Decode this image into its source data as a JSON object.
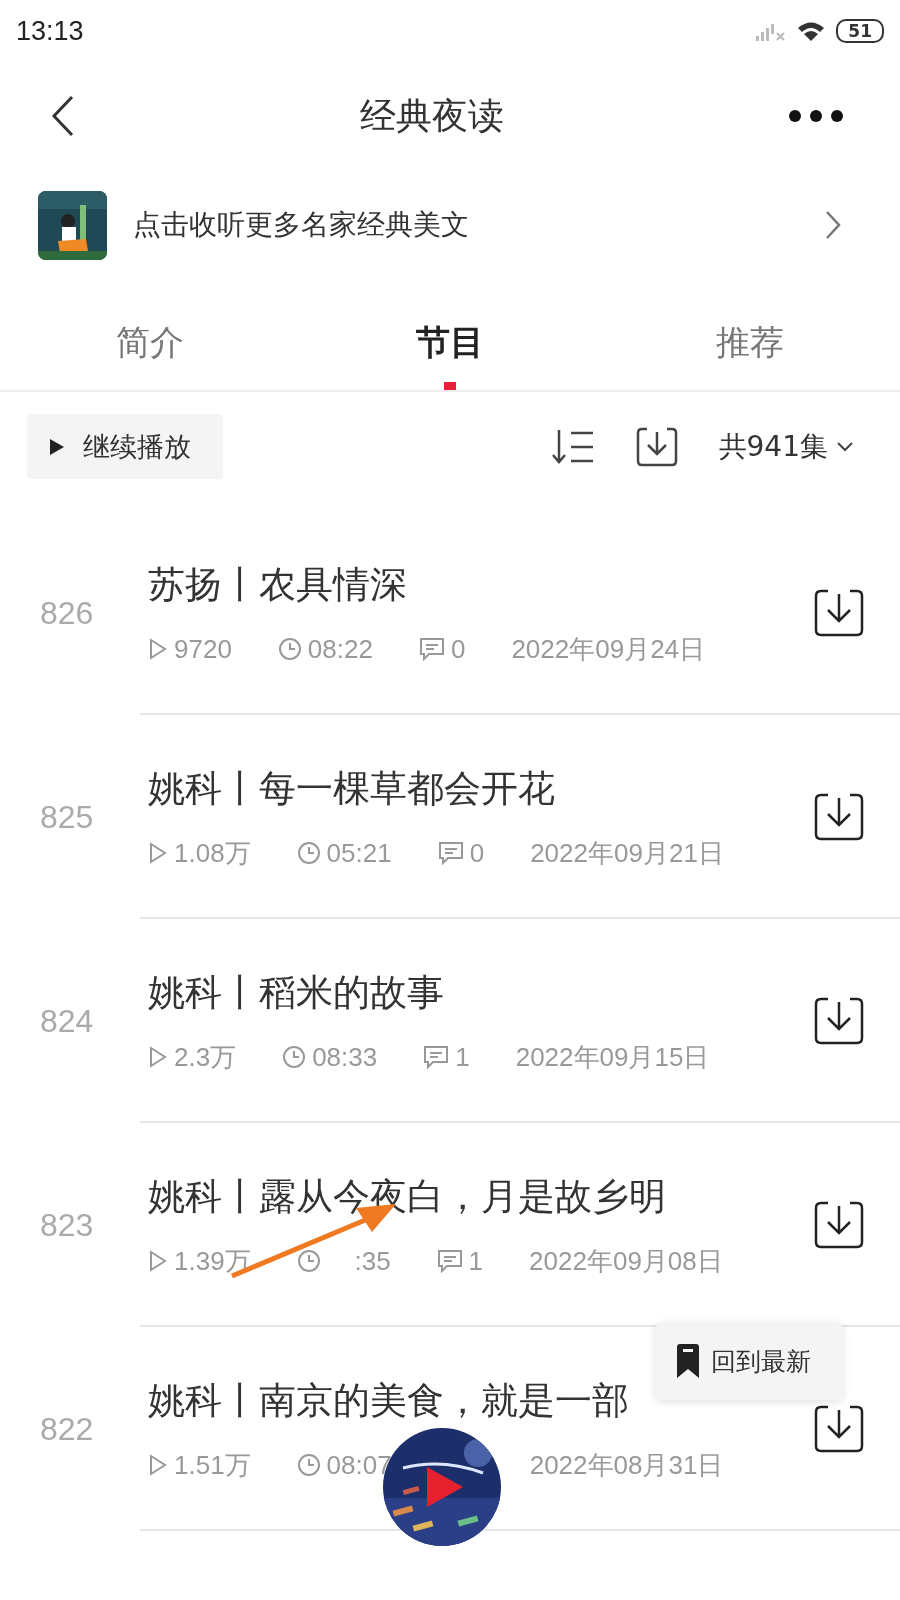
{
  "status_bar": {
    "time": "13:13",
    "battery": "51"
  },
  "header": {
    "title": "经典夜读"
  },
  "banner": {
    "text": "点击收听更多名家经典美文"
  },
  "tabs": [
    {
      "label": "简介",
      "selected": false
    },
    {
      "label": "节目",
      "selected": true
    },
    {
      "label": "推荐",
      "selected": false
    }
  ],
  "toolbar": {
    "continue_label": "继续播放",
    "episode_count": "共941集"
  },
  "episodes": [
    {
      "number": "826",
      "title": "苏扬丨农具情深",
      "plays": "9720",
      "duration": "08:22",
      "comments": "0",
      "date": "2022年09月24日"
    },
    {
      "number": "825",
      "title": "姚科丨每一棵草都会开花",
      "plays": "1.08万",
      "duration": "05:21",
      "comments": "0",
      "date": "2022年09月21日"
    },
    {
      "number": "824",
      "title": "姚科丨稻米的故事",
      "plays": "2.3万",
      "duration": "08:33",
      "comments": "1",
      "date": "2022年09月15日"
    },
    {
      "number": "823",
      "title": "姚科丨露从今夜白，月是故乡明",
      "plays": "1.39万",
      "duration": ":35",
      "comments": "1",
      "date": "2022年09月08日"
    },
    {
      "number": "822",
      "title": "姚科丨南京的美食，就是一部",
      "plays": "1.51万",
      "duration": "08:07",
      "date": "2022年08月31日"
    }
  ],
  "back_to_latest": {
    "label": "回到最新"
  }
}
